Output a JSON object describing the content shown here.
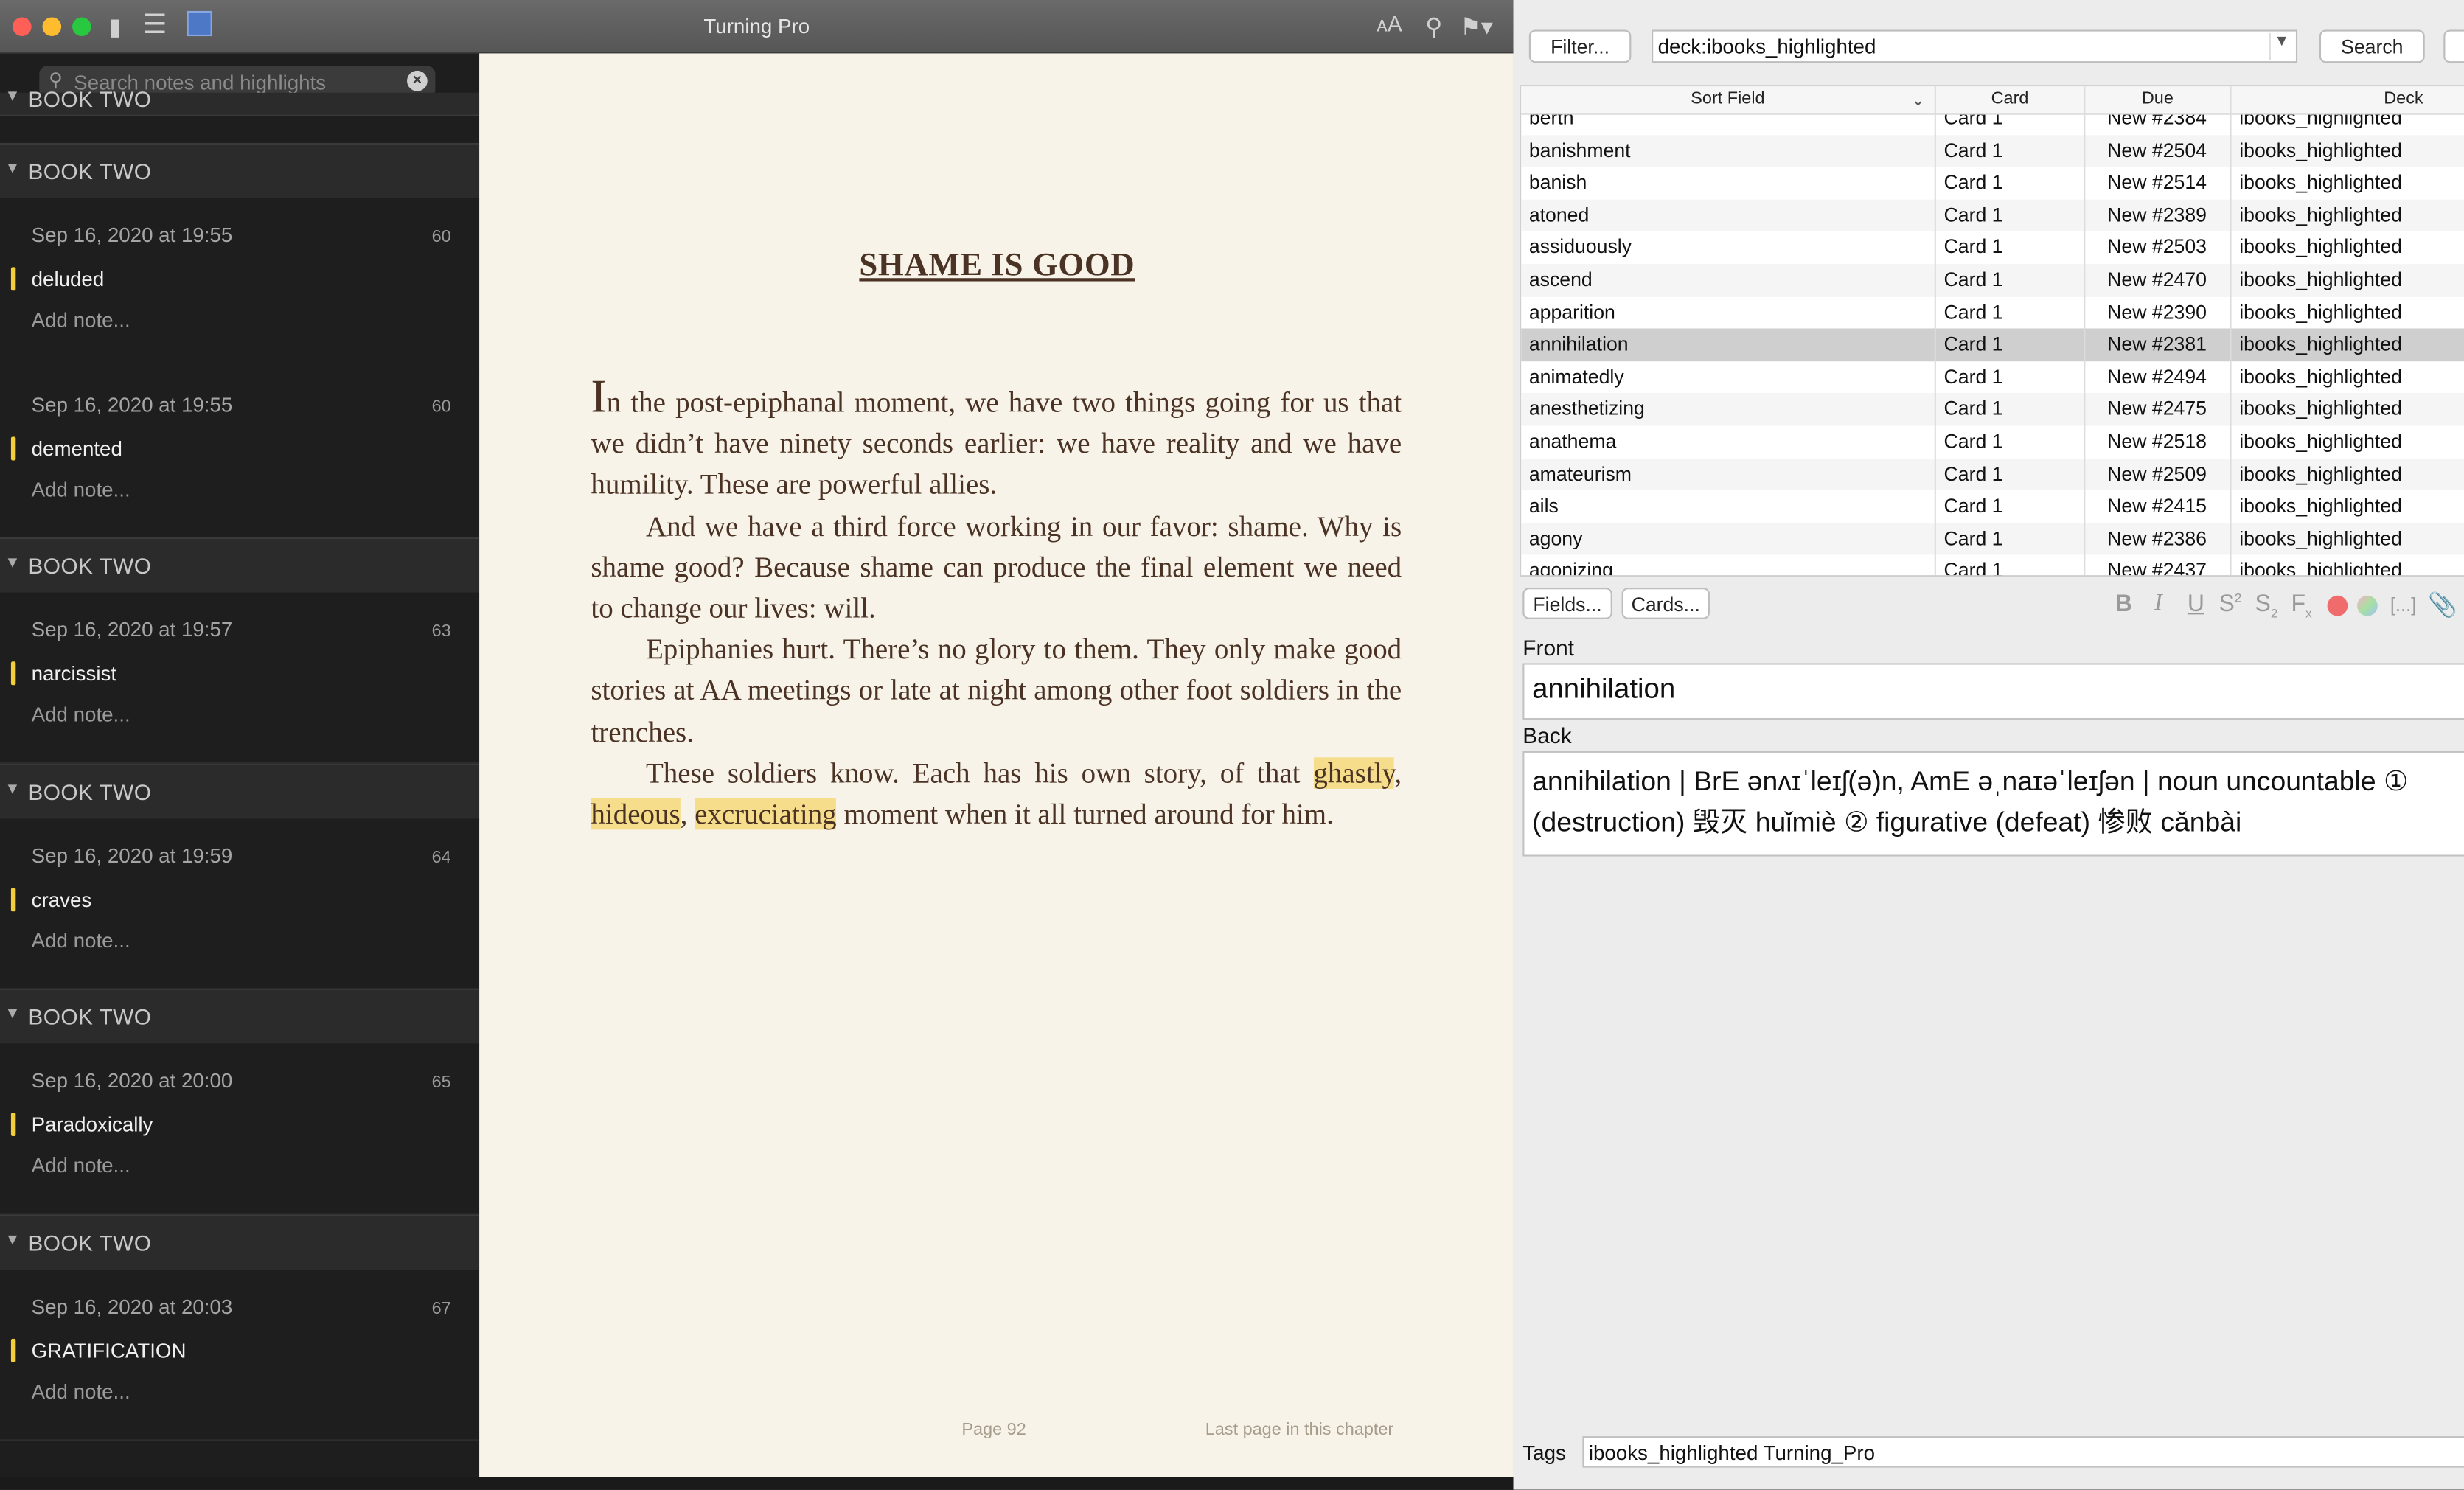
{
  "books": {
    "window_title": "Turning Pro",
    "search_placeholder": "Search notes and highlights",
    "top_partial_section": "BOOK TWO",
    "highlights": [
      {
        "section": "BOOK TWO",
        "date": "Sep 16, 2020 at 19:55",
        "page": "60",
        "word": "deluded",
        "note": "Add note..."
      },
      {
        "section": "",
        "date": "Sep 16, 2020 at 19:55",
        "page": "60",
        "word": "demented",
        "note": "Add note..."
      },
      {
        "section": "BOOK TWO",
        "date": "Sep 16, 2020 at 19:57",
        "page": "63",
        "word": "narcissist",
        "note": "Add note..."
      },
      {
        "section": "BOOK TWO",
        "date": "Sep 16, 2020 at 19:59",
        "page": "64",
        "word": "craves",
        "note": "Add note..."
      },
      {
        "section": "BOOK TWO",
        "date": "Sep 16, 2020 at 20:00",
        "page": "65",
        "word": "Paradoxically",
        "note": "Add note..."
      },
      {
        "section": "BOOK TWO",
        "date": "Sep 16, 2020 at 20:03",
        "page": "67",
        "word": "GRATIFICATION",
        "note": "Add note..."
      }
    ],
    "chapter_title": "SHAME IS GOOD",
    "paragraphs": {
      "p1_dropcap": "I",
      "p1": "n the post-epiphanal moment, we have two things going for us that we didn’t have ninety seconds earlier: we have reality and we have humility. These are powerful allies.",
      "p2": "And we have a third force working in our favor: shame. Why is shame good? Because shame can produce the final element we need to change our lives: will.",
      "p3": "Epiphanies hurt. There’s no glory to them. They only make good stories at AA meetings or late at night among other foot soldiers in the trenches.",
      "p4_a": "These soldiers know. Each has his own story, of that ",
      "p4_h1": "ghastly",
      "p4_b": ", ",
      "p4_h2": "hideous",
      "p4_c": ", ",
      "p4_h3": "excruciating",
      "p4_d": " moment when it all turned around for him."
    },
    "footer_page": "Page 92",
    "footer_note": "Last page in this chapter",
    "colors": {
      "highlight": "#f6dd8c",
      "highlight_bar": "#f2cf3a",
      "text": "#4a3224"
    }
  },
  "anki": {
    "filter_label": "Filter...",
    "search_query": "deck:ibooks_highlighted",
    "search_label": "Search",
    "columns": [
      "Sort Field",
      "Card",
      "Due",
      "Deck"
    ],
    "rows": [
      {
        "sort": "berth",
        "card": "Card 1",
        "due": "New #2384",
        "deck": "ibooks_highlighted"
      },
      {
        "sort": "banishment",
        "card": "Card 1",
        "due": "New #2504",
        "deck": "ibooks_highlighted"
      },
      {
        "sort": "banish",
        "card": "Card 1",
        "due": "New #2514",
        "deck": "ibooks_highlighted"
      },
      {
        "sort": "atoned",
        "card": "Card 1",
        "due": "New #2389",
        "deck": "ibooks_highlighted"
      },
      {
        "sort": "assiduously",
        "card": "Card 1",
        "due": "New #2503",
        "deck": "ibooks_highlighted"
      },
      {
        "sort": "ascend",
        "card": "Card 1",
        "due": "New #2470",
        "deck": "ibooks_highlighted"
      },
      {
        "sort": "apparition",
        "card": "Card 1",
        "due": "New #2390",
        "deck": "ibooks_highlighted"
      },
      {
        "sort": "annihilation",
        "card": "Card 1",
        "due": "New #2381",
        "deck": "ibooks_highlighted",
        "selected": true
      },
      {
        "sort": "animatedly",
        "card": "Card 1",
        "due": "New #2494",
        "deck": "ibooks_highlighted"
      },
      {
        "sort": "anesthetizing",
        "card": "Card 1",
        "due": "New #2475",
        "deck": "ibooks_highlighted"
      },
      {
        "sort": "anathema",
        "card": "Card 1",
        "due": "New #2518",
        "deck": "ibooks_highlighted"
      },
      {
        "sort": "amateurism",
        "card": "Card 1",
        "due": "New #2509",
        "deck": "ibooks_highlighted"
      },
      {
        "sort": "ails",
        "card": "Card 1",
        "due": "New #2415",
        "deck": "ibooks_highlighted"
      },
      {
        "sort": "agony",
        "card": "Card 1",
        "due": "New #2386",
        "deck": "ibooks_highlighted"
      },
      {
        "sort": "agonizing",
        "card": "Card 1",
        "due": "New #2437",
        "deck": "ibooks_highlighted"
      }
    ],
    "fields_label": "Fields...",
    "cards_label": "Cards...",
    "front_label": "Front",
    "front_value": "annihilation",
    "back_label": "Back",
    "back_value": "annihilation | BrE ənʌɪˈleɪʃ(ə)n, AmE əˌnaɪəˈleɪʃən | noun uncountable ① (destruction) 毁灭 huǐmiè ② figurative (defeat) 惨败 cǎnbài",
    "tags_label": "Tags",
    "tags_value": "ibooks_highlighted Turning_Pro",
    "colors": {
      "selected_row": "#cfcfcf",
      "color_red": "#f06b6b"
    }
  }
}
